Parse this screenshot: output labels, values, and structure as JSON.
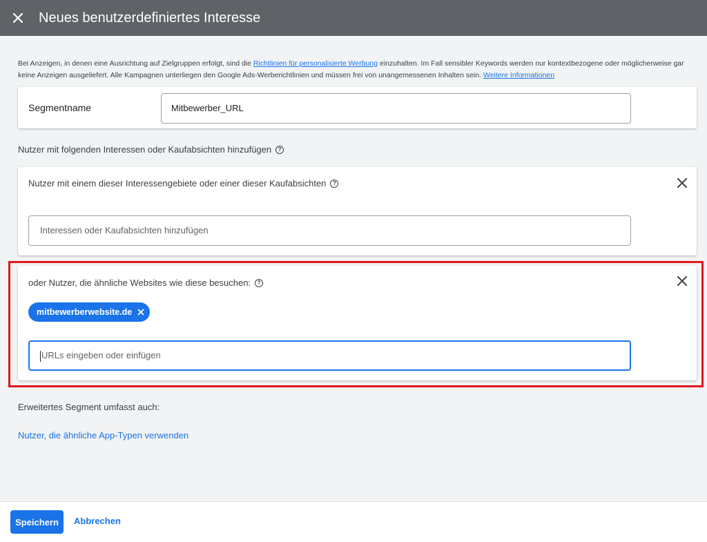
{
  "header": {
    "title": "Neues benutzerdefiniertes Interesse",
    "close_icon": "close-icon"
  },
  "notice": {
    "text_1": "Bei Anzeigen, in denen eine Ausrichtung auf Zielgruppen erfolgt, sind die ",
    "link_1": "Richtlinien für personalisierte Werbung",
    "text_2": " einzuhalten. Im Fall sensibler Keywords werden nur kontextbezogene oder möglicherweise gar keine Anzeigen ausgeliefert. Alle Kampagnen unterliegen den Google Ads-Werberichtlinien und müssen frei von unangemessenen Inhalten sein. ",
    "link_2": "Weitere Informationen"
  },
  "segment": {
    "label": "Segmentname",
    "value": "Mitbewerber_URL"
  },
  "section_label": "Nutzer mit folgenden Interessen oder Kaufabsichten hinzufügen",
  "interest_card": {
    "title": "Nutzer mit einem dieser Interessengebiete oder einer dieser Kaufabsichten",
    "placeholder": "Interessen oder Kaufabsichten hinzufügen"
  },
  "sites_card": {
    "title": "oder Nutzer, die ähnliche Websites wie diese besuchen:",
    "chips": [
      "mitbewerberwebsite.de"
    ],
    "placeholder": "URLs eingeben oder einfügen"
  },
  "extended_label": "Erweitertes Segment umfasst auch:",
  "app_link": "Nutzer, die ähnliche App-Typen verwenden",
  "footer": {
    "save": "Speichern",
    "cancel": "Abbrechen"
  },
  "colors": {
    "header_bg": "#5f6368",
    "accent": "#1a73e8",
    "highlight": "#e0161e",
    "page_bg": "#f1f3f4"
  }
}
